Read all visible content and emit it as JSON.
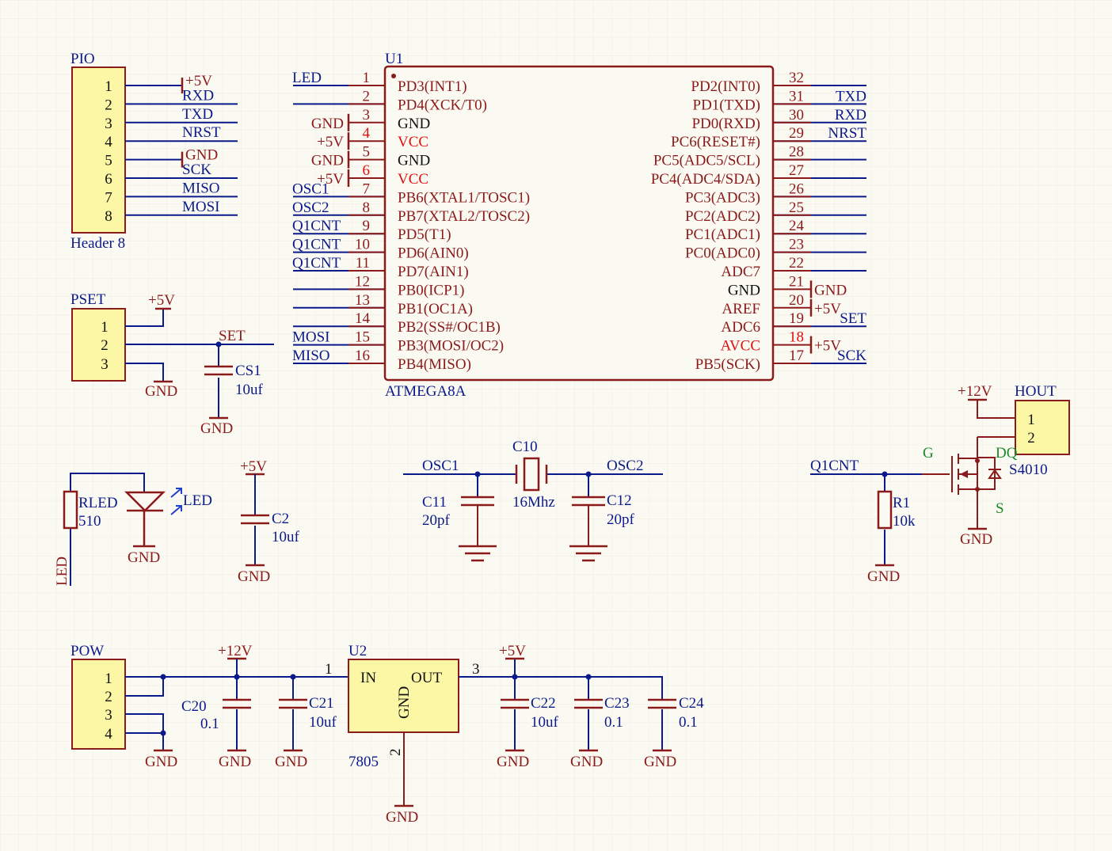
{
  "pio": {
    "title": "PIO",
    "subtitle": "Header 8",
    "pins": [
      "1",
      "2",
      "3",
      "4",
      "5",
      "6",
      "7",
      "8"
    ],
    "nets": [
      "+5V",
      "RXD",
      "TXD",
      "NRST",
      "GND",
      "SCK",
      "MISO",
      "MOSI"
    ]
  },
  "pset": {
    "title": "PSET",
    "pins": [
      "1",
      "2",
      "3"
    ],
    "vcc": "+5V",
    "net": "SET",
    "gnd": "GND",
    "cap": "CS1",
    "cap_value": "10uf",
    "cap_gnd": "GND"
  },
  "u1": {
    "ref": "U1",
    "part": "ATMEGA8A",
    "left_nets": [
      "LED",
      "",
      "GND",
      "+5V",
      "GND",
      "+5V",
      "OSC1",
      "OSC2",
      "Q1CNT",
      "Q1CNT",
      "Q1CNT",
      "",
      "",
      "",
      "MOSI",
      "MISO"
    ],
    "left_pins": [
      "1",
      "2",
      "3",
      "4",
      "5",
      "6",
      "7",
      "8",
      "9",
      "10",
      "11",
      "12",
      "13",
      "14",
      "15",
      "16"
    ],
    "left_names": [
      "PD3(INT1)",
      "PD4(XCK/T0)",
      "GND",
      "VCC",
      "GND",
      "VCC",
      "PB6(XTAL1/TOSC1)",
      "PB7(XTAL2/TOSC2)",
      "PD5(T1)",
      "PD6(AIN0)",
      "PD7(AIN1)",
      "PB0(ICP1)",
      "PB1(OC1A)",
      "PB2(SS#/OC1B)",
      "PB3(MOSI/OC2)",
      "PB4(MISO)"
    ],
    "right_names": [
      "PD2(INT0)",
      "PD1(TXD)",
      "PD0(RXD)",
      "PC6(RESET#)",
      "PC5(ADC5/SCL)",
      "PC4(ADC4/SDA)",
      "PC3(ADC3)",
      "PC2(ADC2)",
      "PC1(ADC1)",
      "PC0(ADC0)",
      "ADC7",
      "GND",
      "AREF",
      "ADC6",
      "AVCC",
      "PB5(SCK)"
    ],
    "right_pins": [
      "32",
      "31",
      "30",
      "29",
      "28",
      "27",
      "26",
      "25",
      "24",
      "23",
      "22",
      "21",
      "20",
      "19",
      "18",
      "17"
    ],
    "right_nets": [
      "",
      "TXD",
      "RXD",
      "NRST",
      "",
      "",
      "",
      "",
      "",
      "",
      "",
      "GND",
      "+5V",
      "SET",
      "+5V",
      "SCK"
    ]
  },
  "led": {
    "res": "RLED",
    "res_value": "510",
    "diode": "LED",
    "gnd": "GND",
    "net": "LED"
  },
  "c2": {
    "vcc": "+5V",
    "ref": "C2",
    "value": "10uf",
    "gnd": "GND"
  },
  "osc": {
    "osc1": "OSC1",
    "osc2": "OSC2",
    "xtal": "C10",
    "xtal_value": "16Mhz",
    "c11": "C11",
    "c11_value": "20pf",
    "c12": "C12",
    "c12_value": "20pf"
  },
  "hout": {
    "vcc": "+12V",
    "title": "HOUT",
    "pins": [
      "1",
      "2"
    ],
    "net": "Q1CNT",
    "r": "R1",
    "r_value": "10k",
    "r_gnd": "GND",
    "q_ref": "DQ",
    "q_part": "S4010",
    "g": "G",
    "s": "S",
    "q_gnd": "GND"
  },
  "pow": {
    "title": "POW",
    "pins": [
      "1",
      "2",
      "3",
      "4"
    ],
    "gnd": "GND",
    "vin": "+12V",
    "c20": "C20",
    "c20_value": "0.1",
    "c21": "C21",
    "c21_value": "10uf",
    "u2": "U2",
    "u2_part": "7805",
    "u2_in": "IN",
    "u2_out": "OUT",
    "u2_gnd": "GND",
    "u2_pin_in": "1",
    "u2_pin_out": "3",
    "u2_pin_gnd": "2",
    "vout": "+5V",
    "c22": "C22",
    "c22_value": "10uf",
    "c23": "C23",
    "c23_value": "0.1",
    "c24": "C24",
    "c24_value": "0.1",
    "gnds": [
      "GND",
      "GND",
      "GND",
      "GND",
      "GND",
      "GND"
    ]
  }
}
